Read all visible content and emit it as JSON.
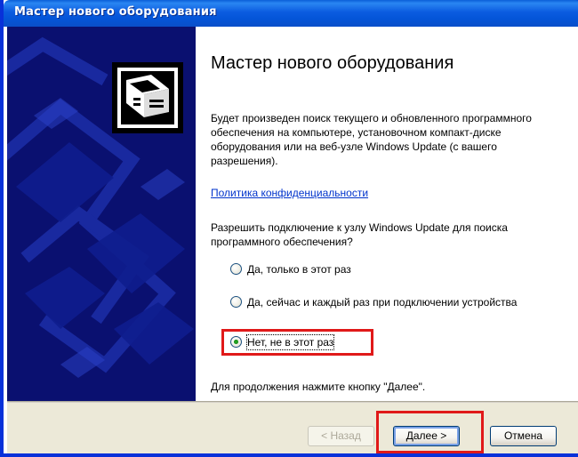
{
  "window": {
    "title": "Мастер нового оборудования"
  },
  "content": {
    "heading": "Мастер нового оборудования",
    "description": "Будет произведен поиск текущего и обновленного программного обеспечения на компьютере, установочном компакт-диске оборудования или на веб-узле Windows Update (с вашего разрешения).",
    "privacy_link": "Политика конфиденциальности",
    "question": "Разрешить подключение к узлу Windows Update для поиска программного обеспечения?",
    "options": [
      {
        "label": "Да, только в этот раз",
        "selected": false
      },
      {
        "label": "Да, сейчас и каждый раз при подключении устройства",
        "selected": false
      },
      {
        "label": "Нет, не в этот раз",
        "selected": true
      }
    ],
    "footer_hint": "Для продолжения нажмите кнопку \"Далее\"."
  },
  "buttons": {
    "back": "< Назад",
    "next": "Далее >",
    "cancel": "Отмена"
  },
  "colors": {
    "titlebar": "#0a5fd8",
    "side_panel": "#0a1070",
    "highlight": "#e01919",
    "link": "#0033cc"
  }
}
